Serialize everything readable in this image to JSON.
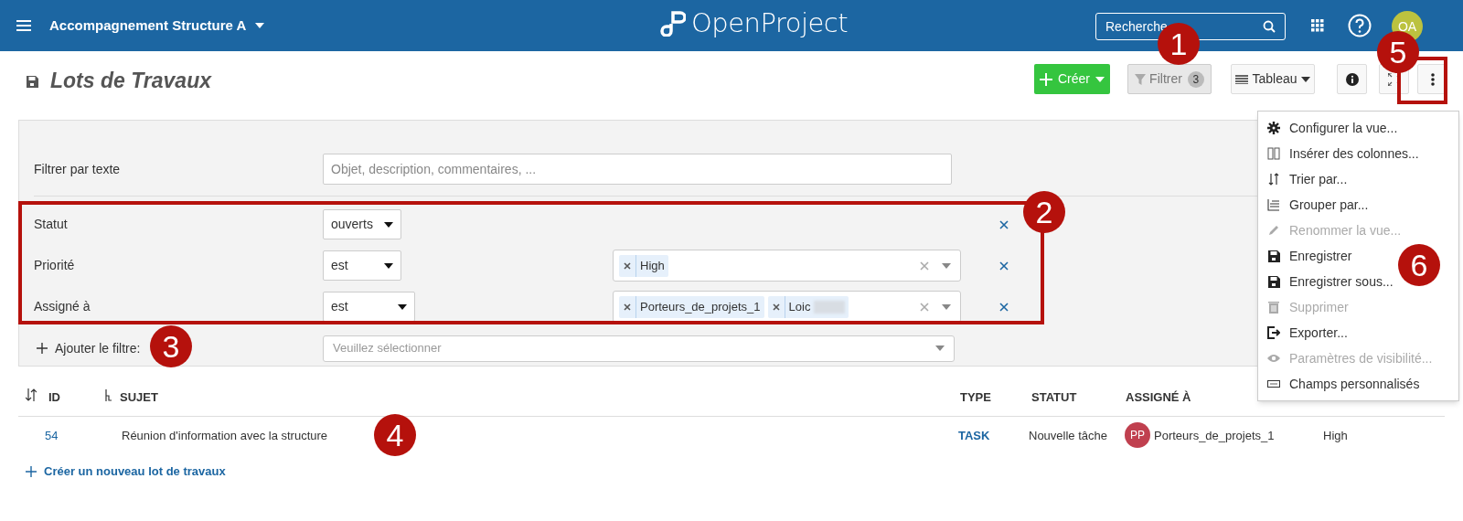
{
  "header": {
    "project": "Accompagnement Structure A",
    "logo": "OpenProject",
    "search": {
      "placeholder": "Recherche"
    },
    "avatar": "OA"
  },
  "page": {
    "title": "Lots de Travaux"
  },
  "toolbar": {
    "create": "Créer",
    "filter": {
      "label": "Filtrer",
      "count": "3",
      "selected": true
    },
    "view": "Tableau"
  },
  "filters": {
    "text": {
      "label": "Filtrer par texte",
      "placeholder": "Objet, description, commentaires, ..."
    },
    "rows": [
      {
        "label": "Statut",
        "operator": "ouverts",
        "values": []
      },
      {
        "label": "Priorité",
        "operator": "est",
        "values": [
          "High"
        ]
      },
      {
        "label": "Assigné à",
        "operator": "est",
        "values": [
          "Porteurs_de_projets_1",
          "Loic"
        ]
      }
    ],
    "add": {
      "label": "Ajouter le filtre:",
      "placeholder": "Veuillez sélectionner"
    }
  },
  "table": {
    "columns": [
      "ID",
      "SUJET",
      "TYPE",
      "STATUT",
      "ASSIGNÉ À"
    ],
    "rows": [
      {
        "id": "54",
        "subject": "Réunion d'information avec la structure",
        "type": "TASK",
        "status": "Nouvelle tâche",
        "assignee_initials": "PP",
        "assignee": "Porteurs_de_projets_1",
        "priority": "High"
      }
    ],
    "create_link": "Créer un nouveau lot de travaux"
  },
  "menu": [
    {
      "kind": "gear",
      "label": "Configurer la vue...",
      "disabled": false
    },
    {
      "kind": "columns",
      "label": "Insérer des colonnes...",
      "disabled": false
    },
    {
      "kind": "sort",
      "label": "Trier par...",
      "disabled": false
    },
    {
      "kind": "group",
      "label": "Grouper par...",
      "disabled": false
    },
    {
      "kind": "pencil",
      "label": "Renommer la vue...",
      "disabled": true
    },
    {
      "kind": "save",
      "label": "Enregistrer",
      "disabled": false
    },
    {
      "kind": "save",
      "label": "Enregistrer sous...",
      "disabled": false
    },
    {
      "kind": "trash",
      "label": "Supprimer",
      "disabled": true
    },
    {
      "kind": "export",
      "label": "Exporter...",
      "disabled": false
    },
    {
      "kind": "eye",
      "label": "Paramètres de visibilité...",
      "disabled": true
    },
    {
      "kind": "field",
      "label": "Champs personnalisés",
      "disabled": false
    }
  ],
  "annotations": [
    {
      "label": "1"
    },
    {
      "label": "2"
    },
    {
      "label": "3"
    },
    {
      "label": "4"
    },
    {
      "label": "5"
    },
    {
      "label": "6"
    }
  ]
}
